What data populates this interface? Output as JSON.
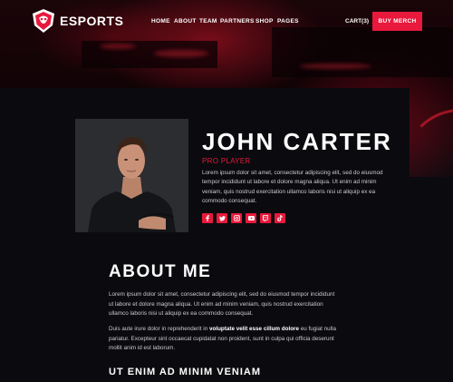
{
  "header": {
    "brand": "ESPORTS",
    "nav": [
      "HOME",
      "ABOUT",
      "TEAM",
      "PARTNERS",
      "SHOP",
      "PAGES"
    ],
    "cart_label": "CART(3)",
    "buy_label": "BUY MERCH"
  },
  "profile": {
    "name": "JOHN CARTER",
    "role": "PRO PLAYER",
    "bio": "Lorem ipsum dolor sit amet, consectetur adipiscing elit, sed do eiusmod tempor incididunt ut labore et dolore magna aliqua. Ut enim ad minim veniam, quis nostrud exercitation ullamco laboris nisi ut aliquip ex ea commodo consequat.",
    "socials": [
      "facebook-icon",
      "twitter-icon",
      "instagram-icon",
      "youtube-icon",
      "twitch-icon",
      "tiktok-icon"
    ]
  },
  "about": {
    "title": "ABOUT ME",
    "p1": "Lorem ipsum dolor sit amet, consectetur adipiscing elit, sed do eiusmod tempor incididunt ut labore et dolore magna aliqua. Ut enim ad minim veniam, quis nostrud exercitation ullamco laboris nisi ut aliquip ex ea commodo consequat.",
    "p2_before": "Duis aute irure dolor in reprehenderit in ",
    "p2_bold": "voluptate velit esse cillum dolore",
    "p2_after": " eu fugiat nulla pariatur. Excepteur sint occaecat cupidatat non proident, sunt in culpa qui officia deserunt mollit anim id est laborum.",
    "subtitle": "UT ENIM AD MINIM VENIAM"
  },
  "colors": {
    "accent": "#e8193c",
    "background": "#0b0b0f"
  }
}
